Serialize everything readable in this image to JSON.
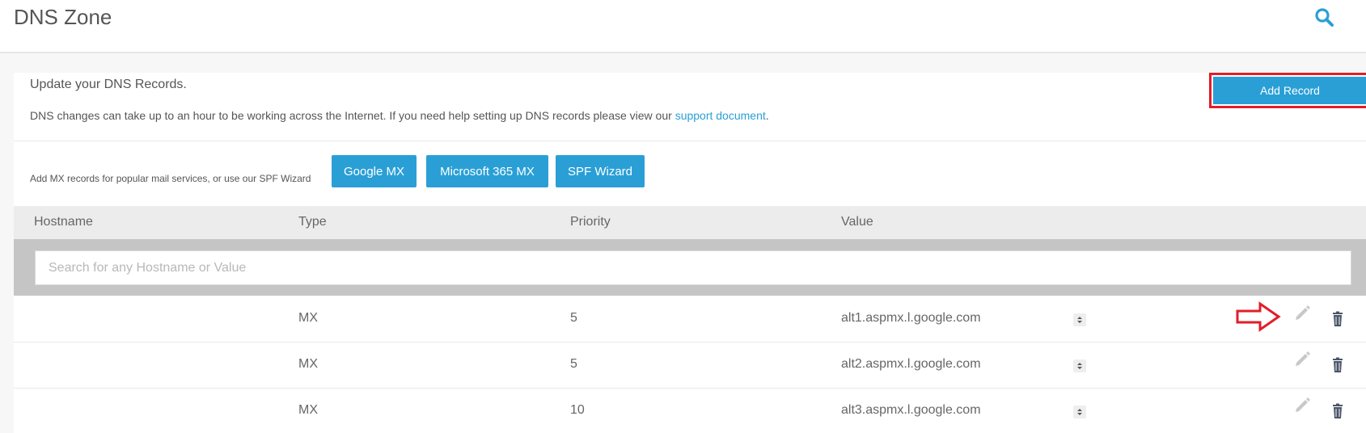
{
  "header": {
    "title": "DNS Zone",
    "search_icon": "search-icon"
  },
  "intro": {
    "title": "Update your DNS Records.",
    "text_before_link": "DNS changes can take up to an hour to be working across the Internet. If you need help setting up DNS records please view our ",
    "link_text": "support document",
    "text_after_link": ".",
    "add_record_label": "Add Record"
  },
  "mx_bar": {
    "label": "Add MX records for popular mail services, or use our SPF Wizard",
    "buttons": [
      "Google MX",
      "Microsoft 365 MX",
      "SPF Wizard"
    ]
  },
  "table": {
    "columns": [
      "Hostname",
      "Type",
      "Priority",
      "Value"
    ],
    "search_placeholder": "Search for any Hostname or Value",
    "rows": [
      {
        "hostname": "",
        "type": "MX",
        "priority": "5",
        "value": "alt1.aspmx.l.google.com"
      },
      {
        "hostname": "",
        "type": "MX",
        "priority": "5",
        "value": "alt2.aspmx.l.google.com"
      },
      {
        "hostname": "",
        "type": "MX",
        "priority": "10",
        "value": "alt3.aspmx.l.google.com"
      }
    ]
  },
  "colors": {
    "accent": "#2a9fd6",
    "highlight": "#e21d2a",
    "header_bg": "#ececec",
    "search_band_bg": "#c5c5c5"
  }
}
